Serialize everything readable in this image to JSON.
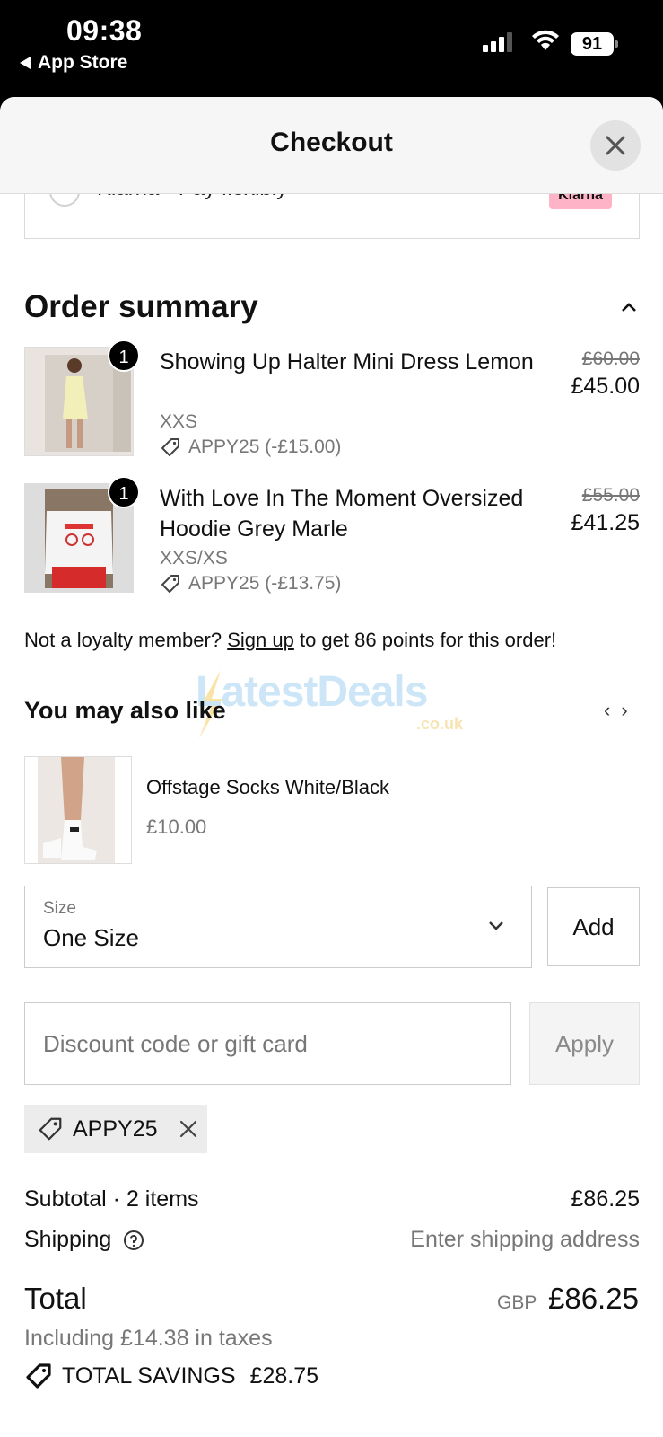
{
  "status_bar": {
    "time": "09:38",
    "back_app": "App Store",
    "battery": "91",
    "icons": [
      "signal-icon",
      "wifi-icon",
      "battery-icon"
    ]
  },
  "header": {
    "title": "Checkout",
    "close_icon": "close-icon"
  },
  "payment": {
    "klarna_label": "Klarna - Pay flexibly",
    "klarna_badge": "Klarna"
  },
  "order_summary": {
    "title": "Order summary",
    "items": [
      {
        "quantity": "1",
        "name": "Showing Up Halter Mini Dress Lemon",
        "variant": "XXS",
        "discount": "APPY25 (-£15.00)",
        "original_price": "£60.00",
        "price": "£45.00"
      },
      {
        "quantity": "1",
        "name": "With Love In The Moment Oversized Hoodie Grey Marle",
        "variant": "XXS/XS",
        "discount": "APPY25 (-£13.75)",
        "original_price": "£55.00",
        "price": "£41.25"
      }
    ]
  },
  "loyalty": {
    "prefix": "Not a loyalty member?",
    "link": "Sign up",
    "suffix": "to get 86 points for this order!"
  },
  "watermark": {
    "text": "LatestDeals",
    "sub": ".co.uk"
  },
  "recommendations": {
    "title": "You may also like",
    "prev": "‹",
    "next": "›",
    "product": {
      "name": "Offstage Socks White/Black",
      "price": "£10.00"
    },
    "size_label": "Size",
    "size_value": "One Size",
    "add_label": "Add"
  },
  "discount": {
    "placeholder": "Discount code or gift card",
    "apply_label": "Apply",
    "applied_code": "APPY25"
  },
  "totals": {
    "subtotal_label": "Subtotal · 2 items",
    "subtotal_value": "£86.25",
    "shipping_label": "Shipping",
    "shipping_value": "Enter shipping address",
    "total_label": "Total",
    "currency": "GBP",
    "total_value": "£86.25",
    "taxes": "Including £14.38 in taxes",
    "savings_label": "TOTAL SAVINGS",
    "savings_value": "£28.75"
  }
}
